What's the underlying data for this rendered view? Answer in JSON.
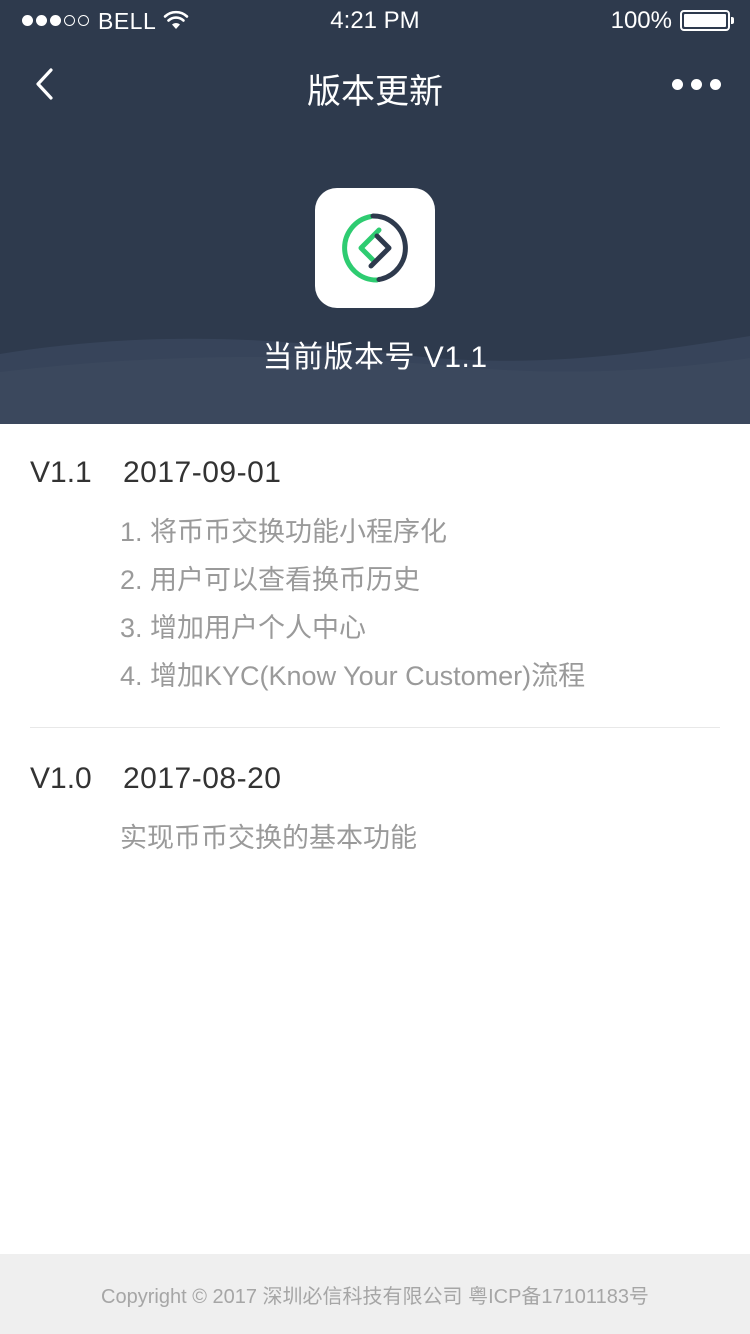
{
  "status_bar": {
    "carrier": "BELL",
    "time": "4:21 PM",
    "battery": "100%"
  },
  "nav": {
    "title": "版本更新"
  },
  "header": {
    "current_version": "当前版本号 V1.1"
  },
  "colors": {
    "header_bg": "#2e3a4d",
    "wave": "#3a4659",
    "logo_green": "#2ecc71",
    "logo_dark": "#2e3a4d"
  },
  "releases": [
    {
      "version": "V1.1",
      "date": "2017-09-01",
      "notes": [
        "1. 将币币交换功能小程序化",
        "2. 用户可以查看换币历史",
        "3. 增加用户个人中心",
        "4. 增加KYC(Know Your Customer)流程"
      ]
    },
    {
      "version": "V1.0",
      "date": "2017-08-20",
      "notes": [
        "实现币币交换的基本功能"
      ]
    }
  ],
  "footer": {
    "copyright": "Copyright © 2017 深圳必信科技有限公司 粤ICP备17101183号"
  }
}
